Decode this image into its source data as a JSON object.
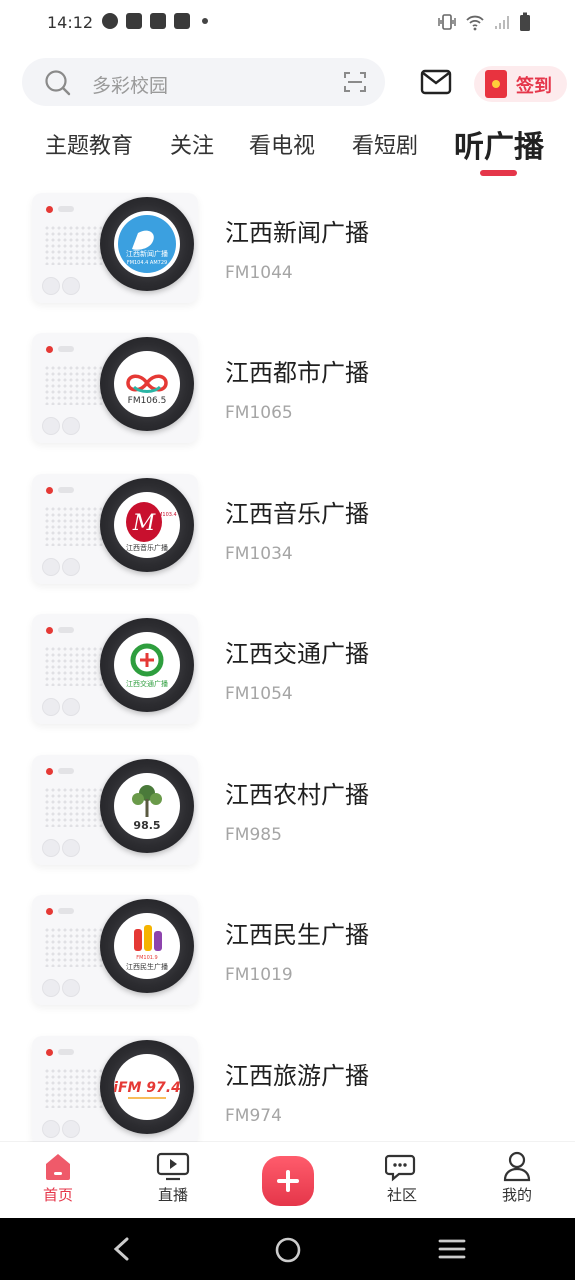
{
  "status_bar": {
    "time": "14:12"
  },
  "search": {
    "placeholder": "多彩校园"
  },
  "signin": {
    "label": "签到"
  },
  "tabs": [
    {
      "label": "主题教育"
    },
    {
      "label": "关注"
    },
    {
      "label": "看电视"
    },
    {
      "label": "看短剧"
    },
    {
      "label": "听广播",
      "active": true
    }
  ],
  "stations": [
    {
      "name": "江西新闻广播",
      "freq": "FM1044",
      "logo_text": "江西新闻广播",
      "logo_sub": "FM104.4 AM729"
    },
    {
      "name": "江西都市广播",
      "freq": "FM1065",
      "logo_text": "FM106.5"
    },
    {
      "name": "江西音乐广播",
      "freq": "FM1034",
      "logo_text": "江西音乐广播",
      "logo_sub": "FM103.4"
    },
    {
      "name": "江西交通广播",
      "freq": "FM1054",
      "logo_text": "江西交通广播"
    },
    {
      "name": "江西农村广播",
      "freq": "FM985",
      "logo_text": "98.5"
    },
    {
      "name": "江西民生广播",
      "freq": "FM1019",
      "logo_text": "江西民生广播",
      "logo_sub": "FM101.9"
    },
    {
      "name": "江西旅游广播",
      "freq": "FM974",
      "logo_text": "iFM 97.4"
    }
  ],
  "bottom_nav": [
    {
      "label": "首页",
      "active": true
    },
    {
      "label": "直播"
    },
    {
      "label": "社区"
    },
    {
      "label": "我的"
    }
  ],
  "colors": {
    "accent": "#e5364a"
  }
}
